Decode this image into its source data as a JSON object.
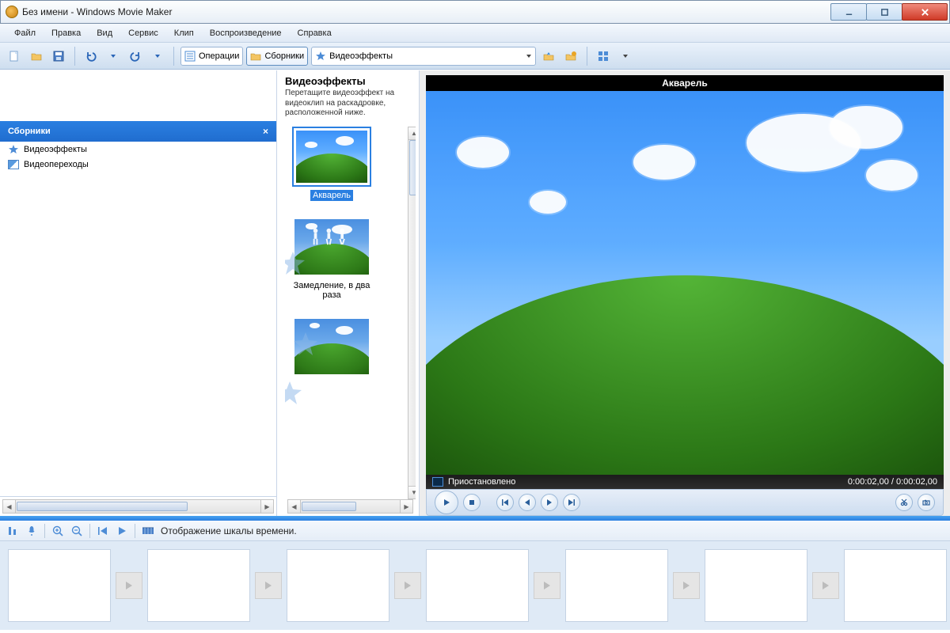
{
  "titlebar": {
    "title": "Без имени - Windows Movie Maker"
  },
  "menubar": [
    "Файл",
    "Правка",
    "Вид",
    "Сервис",
    "Клип",
    "Воспроизведение",
    "Справка"
  ],
  "toolbar": {
    "operations": "Операции",
    "collections": "Сборники",
    "dropdown": "Видеоэффекты"
  },
  "sidebar": {
    "title": "Сборники",
    "items": [
      {
        "icon": "star",
        "label": "Видеоэффекты"
      },
      {
        "icon": "trans",
        "label": "Видеопереходы"
      }
    ]
  },
  "effects_panel": {
    "title": "Видеоэффекты",
    "desc": "Перетащите видеоэффект на видеоклип на раскадровке, расположенной ниже.",
    "items": [
      {
        "label": "Акварель",
        "selected": true
      },
      {
        "label": "Замедление, в два раза",
        "selected": false
      },
      {
        "label": "",
        "selected": false
      }
    ]
  },
  "preview": {
    "title": "Акварель",
    "status": "Приостановлено",
    "time_current": "0:00:02,00",
    "time_total": "0:00:02,00"
  },
  "timeline_toolbar": {
    "label": "Отображение шкалы времени."
  }
}
